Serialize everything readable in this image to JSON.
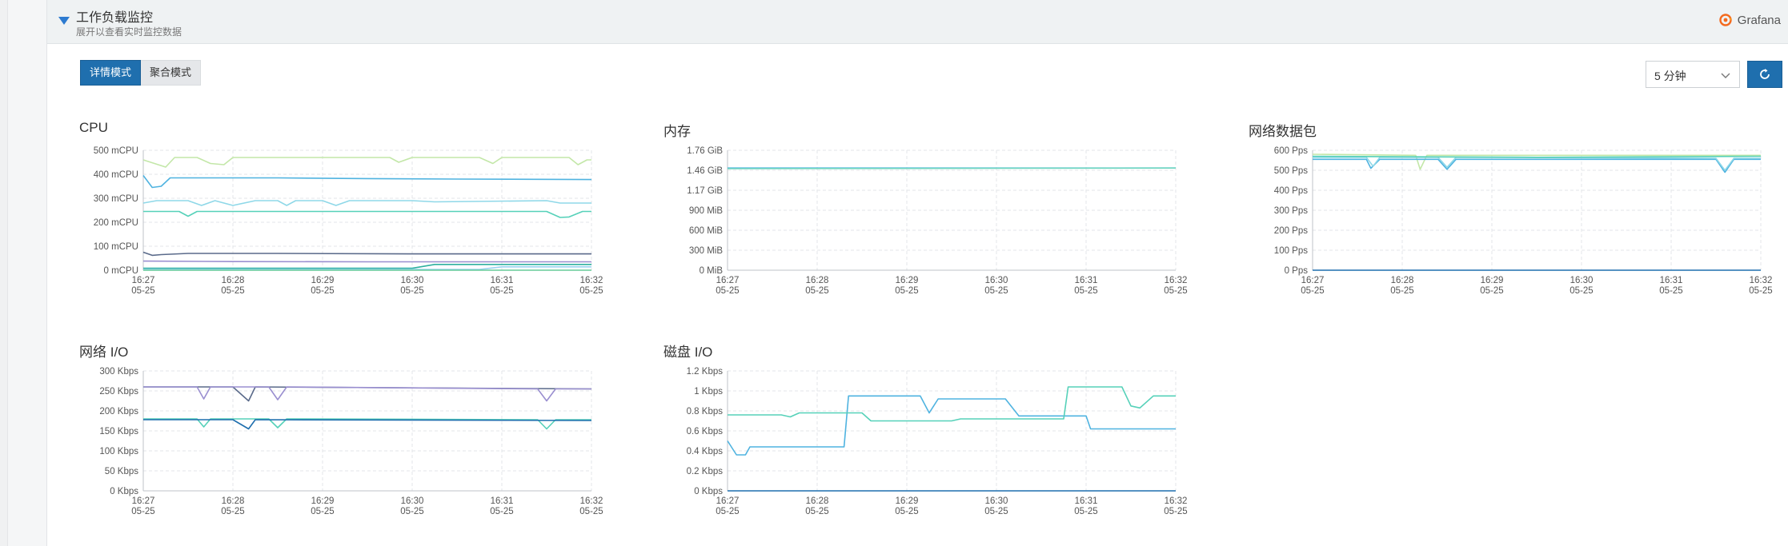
{
  "header": {
    "title": "工作负载监控",
    "subtitle": "展开以查看实时监控数据",
    "brand": "Grafana"
  },
  "modes": {
    "detail_label": "详情模式",
    "aggregate_label": "聚合模式",
    "active": "detail"
  },
  "time_range": {
    "selected": "5 分钟"
  },
  "icons": {
    "collapse": "triangle-down-icon",
    "brand": "grafana-logo-icon",
    "dropdown": "chevron-down-icon",
    "refresh": "refresh-icon"
  },
  "colors": {
    "accent": "#1f6fae",
    "toggle": "#2d7bd0",
    "grafana": "#f46a1e"
  },
  "chart_data": [
    {
      "id": "cpu",
      "title": "CPU",
      "type": "line",
      "x_ticks": [
        [
          "16:27",
          "05-25"
        ],
        [
          "16:28",
          "05-25"
        ],
        [
          "16:29",
          "05-25"
        ],
        [
          "16:30",
          "05-25"
        ],
        [
          "16:31",
          "05-25"
        ],
        [
          "16:32",
          "05-25"
        ]
      ],
      "y_ticks": [
        "0 mCPU",
        "100 mCPU",
        "200 mCPU",
        "300 mCPU",
        "400 mCPU",
        "500 mCPU"
      ],
      "ylim": [
        0,
        500
      ],
      "series": [
        {
          "color": "#c3e7a8",
          "points": [
            [
              0,
              460
            ],
            [
              0.05,
              430
            ],
            [
              0.07,
              470
            ],
            [
              0.12,
              470
            ],
            [
              0.15,
              445
            ],
            [
              0.18,
              440
            ],
            [
              0.2,
              470
            ],
            [
              0.3,
              470
            ],
            [
              0.55,
              470
            ],
            [
              0.57,
              450
            ],
            [
              0.6,
              470
            ],
            [
              0.75,
              470
            ],
            [
              0.78,
              445
            ],
            [
              0.8,
              470
            ],
            [
              0.95,
              470
            ],
            [
              0.97,
              440
            ],
            [
              0.99,
              460
            ],
            [
              1,
              460
            ]
          ]
        },
        {
          "color": "#4fb3e0",
          "points": [
            [
              0,
              395
            ],
            [
              0.02,
              345
            ],
            [
              0.04,
              350
            ],
            [
              0.06,
              385
            ],
            [
              0.12,
              385
            ],
            [
              0.3,
              385
            ],
            [
              0.5,
              382
            ],
            [
              0.7,
              380
            ],
            [
              1,
              378
            ]
          ]
        },
        {
          "color": "#8fd8e8",
          "points": [
            [
              0,
              280
            ],
            [
              0.03,
              290
            ],
            [
              0.1,
              290
            ],
            [
              0.13,
              270
            ],
            [
              0.16,
              290
            ],
            [
              0.2,
              270
            ],
            [
              0.25,
              290
            ],
            [
              0.3,
              290
            ],
            [
              0.32,
              270
            ],
            [
              0.34,
              290
            ],
            [
              0.4,
              290
            ],
            [
              0.43,
              270
            ],
            [
              0.46,
              290
            ],
            [
              0.6,
              290
            ],
            [
              0.65,
              285
            ],
            [
              0.9,
              290
            ],
            [
              0.93,
              280
            ],
            [
              1,
              280
            ]
          ]
        },
        {
          "color": "#56d1b9",
          "points": [
            [
              0,
              245
            ],
            [
              0.08,
              245
            ],
            [
              0.1,
              225
            ],
            [
              0.12,
              245
            ],
            [
              0.3,
              245
            ],
            [
              0.5,
              245
            ],
            [
              0.75,
              245
            ],
            [
              0.9,
              245
            ],
            [
              0.93,
              220
            ],
            [
              0.95,
              222
            ],
            [
              0.98,
              245
            ],
            [
              1,
              245
            ]
          ]
        },
        {
          "color": "#5a6a8a",
          "points": [
            [
              0,
              75
            ],
            [
              0.02,
              62
            ],
            [
              0.04,
              65
            ],
            [
              0.1,
              70
            ],
            [
              0.3,
              70
            ],
            [
              0.6,
              68
            ],
            [
              1,
              68
            ]
          ]
        },
        {
          "color": "#9a8fd0",
          "points": [
            [
              0,
              38
            ],
            [
              0.2,
              36
            ],
            [
              0.5,
              35
            ],
            [
              1,
              35
            ]
          ]
        },
        {
          "color": "#2fb0a0",
          "points": [
            [
              0,
              8
            ],
            [
              0.6,
              8
            ],
            [
              0.65,
              24
            ],
            [
              1,
              24
            ]
          ]
        },
        {
          "color": "#9ad3f0",
          "points": [
            [
              0,
              3
            ],
            [
              0.75,
              3
            ],
            [
              0.8,
              14
            ],
            [
              1,
              14
            ]
          ]
        },
        {
          "color": "#66cc99",
          "points": [
            [
              0,
              0
            ],
            [
              1,
              0
            ]
          ]
        }
      ]
    },
    {
      "id": "memory",
      "title": "内存",
      "type": "line",
      "x_ticks": [
        [
          "16:27",
          "05-25"
        ],
        [
          "16:28",
          "05-25"
        ],
        [
          "16:29",
          "05-25"
        ],
        [
          "16:30",
          "05-25"
        ],
        [
          "16:31",
          "05-25"
        ],
        [
          "16:32",
          "05-25"
        ]
      ],
      "y_ticks": [
        "0 MiB",
        "300 MiB",
        "600 MiB",
        "900 MiB",
        "1.17 GiB",
        "1.46 GiB",
        "1.76 GiB"
      ],
      "ylim": [
        0,
        1.76
      ],
      "series": [
        {
          "color": "#4fb3e0",
          "points": [
            [
              0,
              1.5
            ],
            [
              1,
              1.5
            ]
          ]
        },
        {
          "color": "#6fd6c0",
          "points": [
            [
              0,
              1.49
            ],
            [
              1,
              1.5
            ]
          ]
        }
      ]
    },
    {
      "id": "network-packets",
      "title": "网络数据包",
      "type": "line",
      "x_ticks": [
        [
          "16:27",
          "05-25"
        ],
        [
          "16:28",
          "05-25"
        ],
        [
          "16:29",
          "05-25"
        ],
        [
          "16:30",
          "05-25"
        ],
        [
          "16:31",
          "05-25"
        ],
        [
          "16:32",
          "05-25"
        ]
      ],
      "y_ticks": [
        "0 Pps",
        "100 Pps",
        "200 Pps",
        "300 Pps",
        "400 Pps",
        "500 Pps",
        "600 Pps"
      ],
      "ylim": [
        0,
        600
      ],
      "series": [
        {
          "color": "#c3e7a8",
          "points": [
            [
              0,
              580
            ],
            [
              0.23,
              575
            ],
            [
              0.24,
              505
            ],
            [
              0.255,
              575
            ],
            [
              1,
              575
            ]
          ]
        },
        {
          "color": "#4fb3e0",
          "points": [
            [
              0,
              555
            ],
            [
              0.12,
              555
            ],
            [
              0.13,
              510
            ],
            [
              0.15,
              555
            ],
            [
              0.28,
              555
            ],
            [
              0.3,
              505
            ],
            [
              0.32,
              555
            ],
            [
              0.9,
              555
            ],
            [
              0.92,
              490
            ],
            [
              0.94,
              555
            ],
            [
              1,
              555
            ]
          ]
        },
        {
          "color": "#8fd8e8",
          "points": [
            [
              0,
              565
            ],
            [
              0.12,
              565
            ],
            [
              0.135,
              520
            ],
            [
              0.15,
              565
            ],
            [
              0.28,
              565
            ],
            [
              0.3,
              515
            ],
            [
              0.32,
              565
            ],
            [
              0.9,
              560
            ],
            [
              0.92,
              500
            ],
            [
              0.94,
              560
            ],
            [
              1,
              560
            ]
          ]
        },
        {
          "color": "#56d1b9",
          "points": [
            [
              0,
              570
            ],
            [
              0.5,
              565
            ],
            [
              1,
              570
            ]
          ]
        },
        {
          "color": "#1f6fae",
          "points": [
            [
              0,
              0
            ],
            [
              1,
              0
            ]
          ]
        }
      ]
    },
    {
      "id": "network-io",
      "title": "网络 I/O",
      "type": "line",
      "x_ticks": [
        [
          "16:27",
          "05-25"
        ],
        [
          "16:28",
          "05-25"
        ],
        [
          "16:29",
          "05-25"
        ],
        [
          "16:30",
          "05-25"
        ],
        [
          "16:31",
          "05-25"
        ],
        [
          "16:32",
          "05-25"
        ]
      ],
      "y_ticks": [
        "0 Kbps",
        "50 Kbps",
        "100 Kbps",
        "150 Kbps",
        "200 Kbps",
        "250 Kbps",
        "300 Kbps"
      ],
      "ylim": [
        0,
        300
      ],
      "series": [
        {
          "color": "#5a6a8a",
          "points": [
            [
              0,
              260
            ],
            [
              0.2,
              260
            ],
            [
              0.235,
              225
            ],
            [
              0.25,
              260
            ],
            [
              1,
              255
            ]
          ]
        },
        {
          "color": "#9a8fd0",
          "points": [
            [
              0,
              260
            ],
            [
              0.12,
              260
            ],
            [
              0.135,
              230
            ],
            [
              0.15,
              260
            ],
            [
              0.28,
              260
            ],
            [
              0.3,
              228
            ],
            [
              0.32,
              260
            ],
            [
              0.88,
              255
            ],
            [
              0.9,
              225
            ],
            [
              0.92,
              255
            ],
            [
              1,
              255
            ]
          ]
        },
        {
          "color": "#56d1b9",
          "points": [
            [
              0,
              180
            ],
            [
              0.12,
              180
            ],
            [
              0.135,
              160
            ],
            [
              0.15,
              180
            ],
            [
              0.28,
              180
            ],
            [
              0.3,
              158
            ],
            [
              0.32,
              180
            ],
            [
              0.88,
              178
            ],
            [
              0.9,
              155
            ],
            [
              0.92,
              178
            ],
            [
              1,
              178
            ]
          ]
        },
        {
          "color": "#1f6fae",
          "points": [
            [
              0,
              178
            ],
            [
              0.2,
              178
            ],
            [
              0.235,
              155
            ],
            [
              0.25,
              178
            ],
            [
              1,
              176
            ]
          ]
        }
      ]
    },
    {
      "id": "disk-io",
      "title": "磁盘 I/O",
      "type": "line",
      "x_ticks": [
        [
          "16:27",
          "05-25"
        ],
        [
          "16:28",
          "05-25"
        ],
        [
          "16:29",
          "05-25"
        ],
        [
          "16:30",
          "05-25"
        ],
        [
          "16:31",
          "05-25"
        ],
        [
          "16:32",
          "05-25"
        ]
      ],
      "y_ticks": [
        "0 Kbps",
        "0.2 Kbps",
        "0.4 Kbps",
        "0.6 Kbps",
        "0.8 Kbps",
        "1 Kbps",
        "1.2 Kbps"
      ],
      "ylim": [
        0,
        1.2
      ],
      "series": [
        {
          "color": "#4fb3e0",
          "points": [
            [
              0,
              0.5
            ],
            [
              0.02,
              0.36
            ],
            [
              0.04,
              0.36
            ],
            [
              0.05,
              0.44
            ],
            [
              0.25,
              0.44
            ],
            [
              0.26,
              0.44
            ],
            [
              0.27,
              0.95
            ],
            [
              0.43,
              0.95
            ],
            [
              0.45,
              0.78
            ],
            [
              0.47,
              0.92
            ],
            [
              0.62,
              0.92
            ],
            [
              0.65,
              0.75
            ],
            [
              0.8,
              0.75
            ],
            [
              0.81,
              0.62
            ],
            [
              1,
              0.62
            ]
          ]
        },
        {
          "color": "#56d1b9",
          "points": [
            [
              0,
              0.76
            ],
            [
              0.12,
              0.76
            ],
            [
              0.14,
              0.74
            ],
            [
              0.16,
              0.78
            ],
            [
              0.3,
              0.78
            ],
            [
              0.32,
              0.7
            ],
            [
              0.5,
              0.7
            ],
            [
              0.52,
              0.72
            ],
            [
              0.75,
              0.72
            ],
            [
              0.76,
              1.04
            ],
            [
              0.88,
              1.04
            ],
            [
              0.9,
              0.85
            ],
            [
              0.92,
              0.83
            ],
            [
              0.95,
              0.95
            ],
            [
              1,
              0.95
            ]
          ]
        },
        {
          "color": "#1f6fae",
          "points": [
            [
              0,
              0
            ],
            [
              1,
              0
            ]
          ]
        }
      ]
    }
  ]
}
